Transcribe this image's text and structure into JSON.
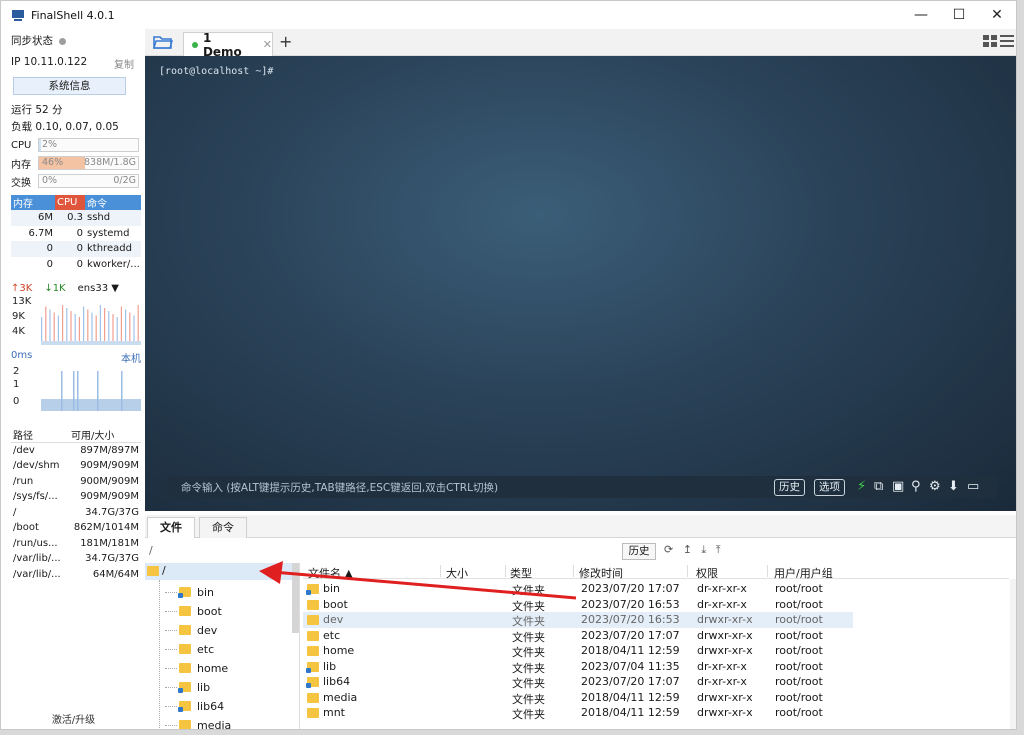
{
  "window": {
    "title": "FinalShell 4.0.1",
    "minimize": "—",
    "maximize": "☐",
    "close": "✕"
  },
  "sidebar": {
    "sync_label": "同步状态",
    "ip_label": "IP  10.11.0.122",
    "copy": "复制",
    "sysinfo_button": "系统信息",
    "uptime": "运行 52 分",
    "load": "负载 0.10, 0.07, 0.05",
    "cpu": {
      "label": "CPU",
      "percent": "2%",
      "value": 0.02
    },
    "mem": {
      "label": "内存",
      "percent": "46%",
      "detail": "838M/1.8G",
      "value": 0.46
    },
    "swap": {
      "label": "交换",
      "percent": "0%",
      "detail": "0/2G",
      "value": 0.0
    },
    "proc_headers": [
      "内存",
      "CPU",
      "命令"
    ],
    "processes": [
      {
        "mem": "6M",
        "cpu": "0.3",
        "cmd": "sshd"
      },
      {
        "mem": "6.7M",
        "cpu": "0",
        "cmd": "systemd"
      },
      {
        "mem": "0",
        "cpu": "0",
        "cmd": "kthreadd"
      },
      {
        "mem": "0",
        "cpu": "0",
        "cmd": "kworker/..."
      }
    ],
    "net": {
      "up": "↑3K",
      "down": "↓1K",
      "iface": "ens33 ▼",
      "ticks": [
        "13K",
        "9K",
        "4K"
      ]
    },
    "ping": {
      "label": "0ms",
      "host": "本机",
      "ticks": [
        "2",
        "1",
        "0"
      ]
    },
    "disk_headers": [
      "路径",
      "可用/大小"
    ],
    "disks": [
      {
        "path": "/dev",
        "size": "897M/897M"
      },
      {
        "path": "/dev/shm",
        "size": "909M/909M"
      },
      {
        "path": "/run",
        "size": "900M/909M"
      },
      {
        "path": "/sys/fs/...",
        "size": "909M/909M"
      },
      {
        "path": "/",
        "size": "34.7G/37G"
      },
      {
        "path": "/boot",
        "size": "862M/1014M"
      },
      {
        "path": "/run/us...",
        "size": "181M/181M"
      },
      {
        "path": "/var/lib/...",
        "size": "34.7G/37G"
      },
      {
        "path": "/var/lib/...",
        "size": "64M/64M"
      }
    ],
    "upgrade": "激活/升级"
  },
  "tabs": {
    "active": "1 Demo",
    "close": "✕",
    "add": "+"
  },
  "terminal": {
    "prompt": "[root@localhost ~]#",
    "cmd_hint": "命令输入 (按ALT键提示历史,TAB键路径,ESC键返回,双击CTRL切换)",
    "history_btn": "历史",
    "options_btn": "选项"
  },
  "bottom": {
    "tab_files": "文件",
    "tab_commands": "命令",
    "path": "/",
    "history_btn": "历史",
    "path_icons": "⟳ ↥ ⤓ ⤒"
  },
  "tree": {
    "root": "/",
    "items": [
      "bin",
      "boot",
      "dev",
      "etc",
      "home",
      "lib",
      "lib64",
      "media"
    ]
  },
  "files": {
    "headers": {
      "name": "文件名 ▲",
      "size": "大小",
      "type": "类型",
      "mtime": "修改时间",
      "perm": "权限",
      "owner": "用户/用户组"
    },
    "rows": [
      {
        "name": "bin",
        "type": "文件夹",
        "mtime": "2023/07/20 17:07",
        "perm": "dr-xr-xr-x",
        "owner": "root/root",
        "link": true
      },
      {
        "name": "boot",
        "type": "文件夹",
        "mtime": "2023/07/20 16:53",
        "perm": "dr-xr-xr-x",
        "owner": "root/root",
        "link": false
      },
      {
        "name": "dev",
        "type": "文件夹",
        "mtime": "2023/07/20 16:53",
        "perm": "drwxr-xr-x",
        "owner": "root/root",
        "link": false
      },
      {
        "name": "etc",
        "type": "文件夹",
        "mtime": "2023/07/20 17:07",
        "perm": "drwxr-xr-x",
        "owner": "root/root",
        "link": false
      },
      {
        "name": "home",
        "type": "文件夹",
        "mtime": "2018/04/11 12:59",
        "perm": "drwxr-xr-x",
        "owner": "root/root",
        "link": false
      },
      {
        "name": "lib",
        "type": "文件夹",
        "mtime": "2023/07/04 11:35",
        "perm": "dr-xr-xr-x",
        "owner": "root/root",
        "link": true
      },
      {
        "name": "lib64",
        "type": "文件夹",
        "mtime": "2023/07/20 17:07",
        "perm": "dr-xr-xr-x",
        "owner": "root/root",
        "link": true
      },
      {
        "name": "media",
        "type": "文件夹",
        "mtime": "2018/04/11 12:59",
        "perm": "drwxr-xr-x",
        "owner": "root/root",
        "link": false
      },
      {
        "name": "mnt",
        "type": "文件夹",
        "mtime": "2018/04/11 12:59",
        "perm": "drwxr-xr-x",
        "owner": "root/root",
        "link": false
      }
    ]
  },
  "colors": {
    "accent": "#4a90d9",
    "cpu_header": "#e0563c",
    "mem_fill": "#f4c3a3",
    "annotation_arrow": "#e02020"
  }
}
